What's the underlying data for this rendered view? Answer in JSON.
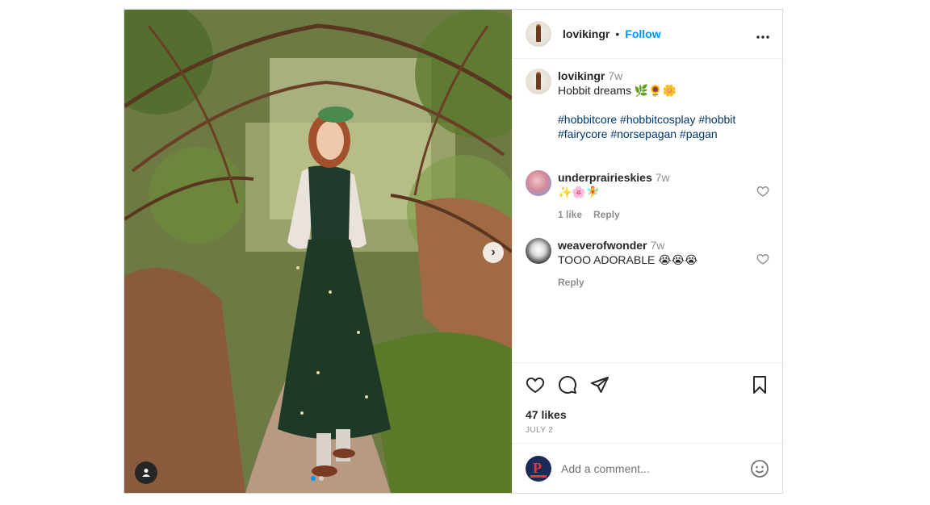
{
  "post": {
    "username": "lovikingr",
    "separator": "•",
    "follow_label": "Follow",
    "more_label": "•••",
    "caption": {
      "username": "lovikingr",
      "time": "7w",
      "text": "Hobbit dreams 🌿🌻🌼",
      "hashtags": "#hobbitcore #hobbitcosplay #hobbit #fairycore #norsepagan #pagan"
    },
    "comments": [
      {
        "username": "underprairieskies",
        "time": "7w",
        "text": "✨🌸🧚",
        "likes": "1 like",
        "reply": "Reply"
      },
      {
        "username": "weaverofwonder",
        "time": "7w",
        "text": "TOOO ADORABLE 😭😭😭",
        "reply": "Reply"
      }
    ],
    "likes": "47 likes",
    "date": "JULY 2",
    "add_comment_placeholder": "Add a comment...",
    "carousel": {
      "current": 1,
      "total": 2
    }
  },
  "icons": {
    "like": "heart-icon",
    "comment": "comment-icon",
    "share": "paper-plane-icon",
    "save": "bookmark-icon",
    "emoji": "smiley-icon",
    "tag": "user-tag-icon",
    "next": "chevron-right-icon"
  },
  "colors": {
    "accent": "#0095f6",
    "hashtag": "#00376b",
    "muted": "#8e8e8e",
    "border": "#dbdbdb"
  }
}
